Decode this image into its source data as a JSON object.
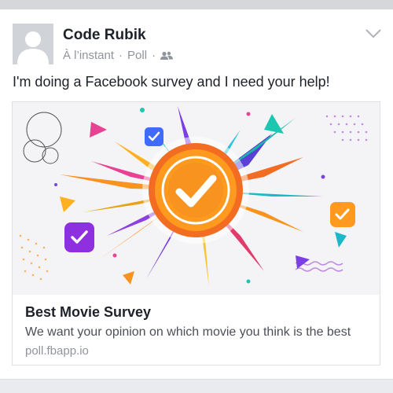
{
  "post": {
    "author": "Code Rubik",
    "time": "À l’instant",
    "separator": "·",
    "type": "Poll",
    "audience_icon": "friends-icon",
    "status_text": "I'm doing a Facebook survey and I need your help!"
  },
  "link_preview": {
    "title": "Best Movie Survey",
    "description": "We want your opinion on which movie you think is the best",
    "domain": "poll.fbapp.io"
  },
  "colors": {
    "accent_orange": "#f7931e",
    "accent_purple": "#7b3fe4",
    "text_primary": "#1d2129",
    "text_secondary": "#90949c"
  }
}
